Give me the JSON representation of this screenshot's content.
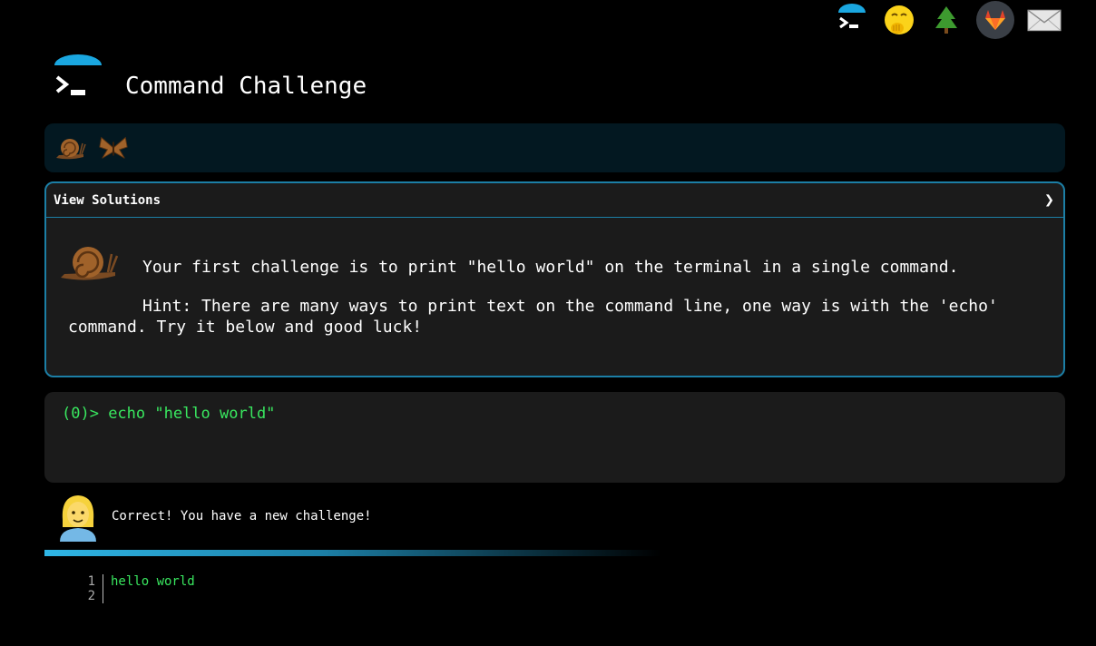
{
  "header": {
    "title": "Command Challenge",
    "icons": [
      "terminal-logo-icon",
      "hand-over-mouth-emoji-icon",
      "tree-icon",
      "gitlab-icon",
      "envelope-icon"
    ]
  },
  "emoji_bar": {
    "items": [
      "snail-icon",
      "butterfly-icon"
    ]
  },
  "challenge": {
    "view_solutions": "View Solutions",
    "chevron": "❯",
    "text": "Your first challenge is to print \"hello world\" on the terminal in a single command.",
    "hint": "Hint: There are many ways to print text on the command line, one way is with the 'echo' command. Try it below and good luck!"
  },
  "terminal": {
    "prompt": "(0)> ",
    "command": "echo \"hello world\""
  },
  "result": {
    "message": "Correct! You have a new challenge!"
  },
  "output": {
    "line_numbers": [
      "1",
      "2"
    ],
    "lines": [
      "hello world",
      ""
    ]
  },
  "colors": {
    "accent": "#1c7fa6",
    "terminal_green": "#39e75f",
    "panel": "#1b1b1b",
    "emoji_bar": "#031821"
  }
}
